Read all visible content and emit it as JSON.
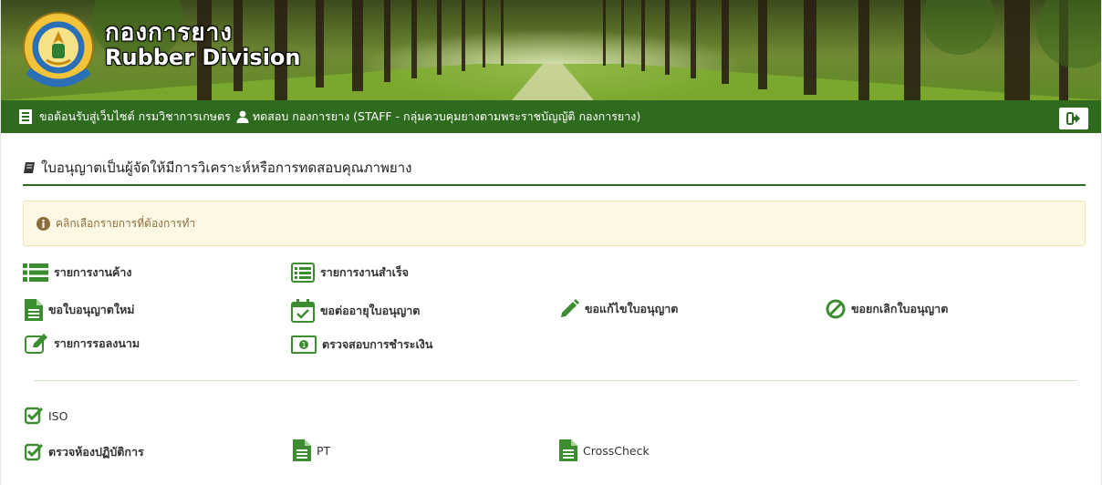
{
  "brand": {
    "thai": "กองการยาง",
    "english": "Rubber Division",
    "logo_ring_text": "กรมวิชาการเกษตร"
  },
  "navbar": {
    "welcome": "ขอต้อนรับสู่เว็บไซต์ กรมวิชาการเกษตร",
    "user": "ทดสอบ กองการยาง (STAFF - กลุ่มควบคุมยางตามพระราชบัญญัติ กองการยาง)"
  },
  "page": {
    "title": "ใบอนุญาตเป็นผู้จัดให้มีการวิเคราะห์หรือการทดสอบคุณภาพยาง"
  },
  "alert": {
    "text": "คลิกเลือกรายการที่ต้องการทำ"
  },
  "menu": {
    "pending": "รายการงานค้าง",
    "completed": "รายการงานสำเร็จ",
    "new_license": "ขอใบอนุญาตใหม่",
    "renew_license": "ขอต่ออายุใบอนุญาต",
    "edit_license": "ขอแก้ไขใบอนุญาต",
    "cancel_license": "ขอยกเลิกใบอนุญาต",
    "awaiting_signature": "รายการรอลงนาม",
    "check_payment": "ตรวจสอบการชำระเงิน"
  },
  "lab": {
    "iso": "ISO",
    "lab_inspection": "ตรวจห้องปฏิบัติการ",
    "pt": "PT",
    "crosscheck": "CrossCheck"
  },
  "colors": {
    "brand_green": "#2f6b1f",
    "icon_green": "#3c8d2f",
    "alert_bg": "#fcf8e3",
    "alert_text": "#8a6d3b"
  }
}
